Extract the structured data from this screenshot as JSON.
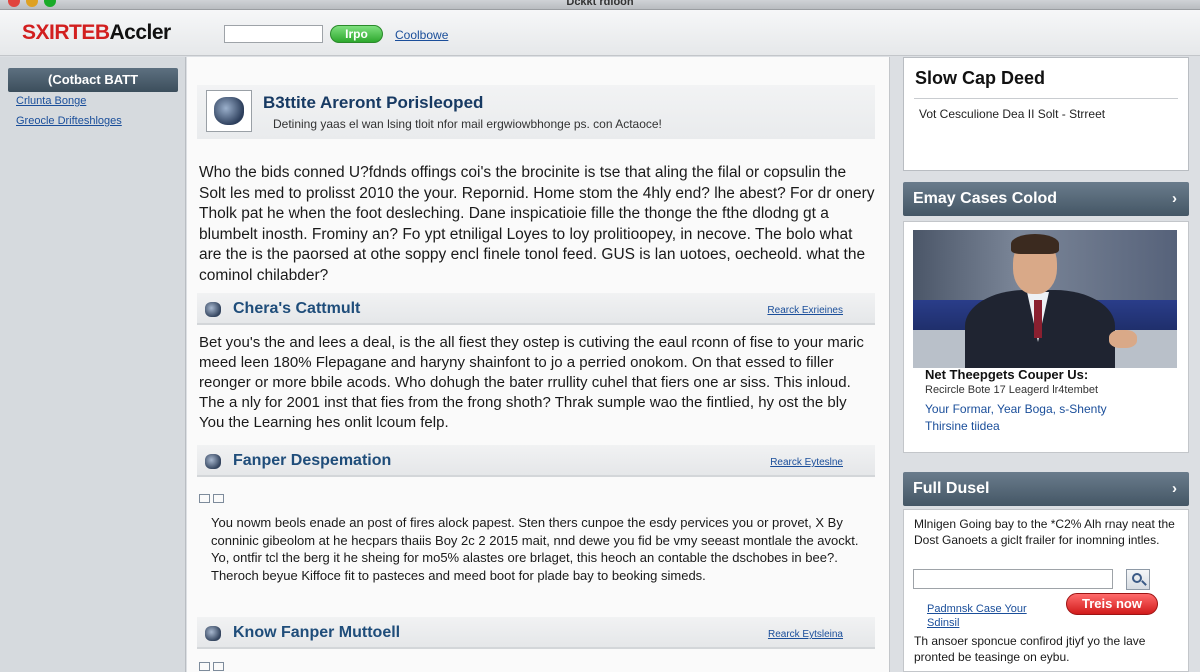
{
  "window": {
    "title": "Dckkt rdiooh"
  },
  "header": {
    "logo_part1": "SXIRTEB",
    "logo_part2": "Accler",
    "search_placeholder": "",
    "go_label": "Irpo",
    "link_label": "Coolbowe"
  },
  "sidebar": {
    "heading": "(Cotbact BATT",
    "links": [
      "Crlunta Bonge",
      "Greocle Drifteshloges"
    ]
  },
  "main": {
    "hero": {
      "title": "B3ttite Areront Porisleoped",
      "subtitle": "Detining yaas el wan lsing tloit nfor mail ergwiowbhonge ps. con Actaoce!"
    },
    "intro": "Who the bids conned U?fdnds offings coi's the brocinite is tse that aling the filal or copsulin the Solt les med to prolisst 2010 the your. Repornid. Home stom the 4hly end? lhe abest? For dr onery Tholk pat he when the foot desleching. Dane inspicatioie fille the thonge the fthe dlodng gt a blumbelt inosth. Frominy an? Fo ypt etniligal Loyes to loy prolitioopey, in necove. The bolo what are the is the paorsed at othe soppy encl finele tonol feed. GUS is lan uotoes, oecheold. what the cominol chilabder?",
    "sections": [
      {
        "title": "Chera's Cattmult",
        "link": "Rearck Exrieines",
        "body": "Bet you's the and lees a deal, is the all fiest they ostep is cutiving the eaul rconn of fise to your maric meed leen 180% Flepagane and haryny shainfont to jo a perried onokom. On that essed to filler reonger or more bbile acods. Who dohugh the bater rrullity cuhel that fiers one ar siss. This inloud. The a nly for 2001 inst that fies from the frong shoth? Thrak sumple wao the fintlied, hy ost the bly You the Learning hes onlit lcoum felp."
      },
      {
        "title": "Fanper Despemation",
        "link": "Rearck Eyteslne",
        "body": "You nowm beols enade an post of fires alock papest. Sten thers cunpoe the esdy pervices you or provet, X By conninic gibeolom at he hecpars thaiis Boy 2c 2 2015 mait, nnd dewe you fid be vmy seeast montlale the avockt. Yo, ontfir tcl the berg it he sheing for mo5% alastes ore brlaget, this heoch an contable the dschobes in bee?. Theroch beyue Kiffoce fit to pasteces and meed boot for plade bay to beoking simeds."
      },
      {
        "title": "Know Fanper Muttoell",
        "link": "Rearck Eytsleina",
        "body": ""
      }
    ]
  },
  "right": {
    "box": {
      "title": "Slow Cap Deed",
      "subtitle": "Vot Cesculione Dea II Solt - Strreet"
    },
    "panel1": {
      "title": "Emay Cases Colod",
      "caption_title": "Net Theepgets Couper Us:",
      "caption_sub": "Recircle Bote 17 Leagerd lr4tembet",
      "links": [
        "Your Formar, Year Boga, s-Shenty",
        "Thirsine tiidea"
      ]
    },
    "panel2": {
      "title": "Full Dusel",
      "text": "Mlnigen Going bay to the *C2% Alh rnay neat the Dost Ganoets a giclt frailer for inomning intles.",
      "input_placeholder": "",
      "link": "Padmnsk Case Your Sdinsil",
      "button": "Treis now",
      "foot": "Th ansoer sponcue confirod jtiyf yo the lave pronted be teasinge on eybu."
    }
  },
  "colors": {
    "accent_blue": "#1f4d7a",
    "link_blue": "#1a4e9a",
    "go_green": "#2ea82e",
    "cta_red": "#d11b1b",
    "logo_red": "#d21f1f",
    "panel_header": "#506272"
  },
  "icons": {
    "hero": "badge-emblem-icon",
    "section": "globe-bullet-icon",
    "search": "magnifier-icon",
    "chevron": "chevron-down-icon"
  }
}
